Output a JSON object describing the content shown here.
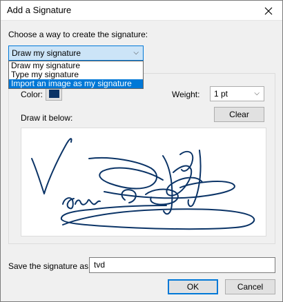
{
  "window": {
    "title": "Add a Signature",
    "close_icon": "close-icon"
  },
  "method": {
    "prompt": "Choose a way to create the signature:",
    "selected": "Draw my signature",
    "options": [
      "Draw my signature",
      "Type my signature",
      "Import an image as my signature"
    ],
    "highlighted_option": "Import an image as my signature"
  },
  "pen": {
    "color_label": "Color:",
    "color": "#0a3366",
    "weight_label": "Weight:",
    "weight_value": "1 pt",
    "clear_label": "Clear"
  },
  "canvas": {
    "label": "Draw it below:",
    "stroke_color": "#0a3366"
  },
  "footer": {
    "save_label": "Save the signature as:",
    "name_value": "tvd",
    "ok_label": "OK",
    "cancel_label": "Cancel"
  },
  "colors": {
    "focus_accent": "#0078d7",
    "select_bg": "#cce4f7",
    "dialog_bg": "#f0f0f0"
  }
}
